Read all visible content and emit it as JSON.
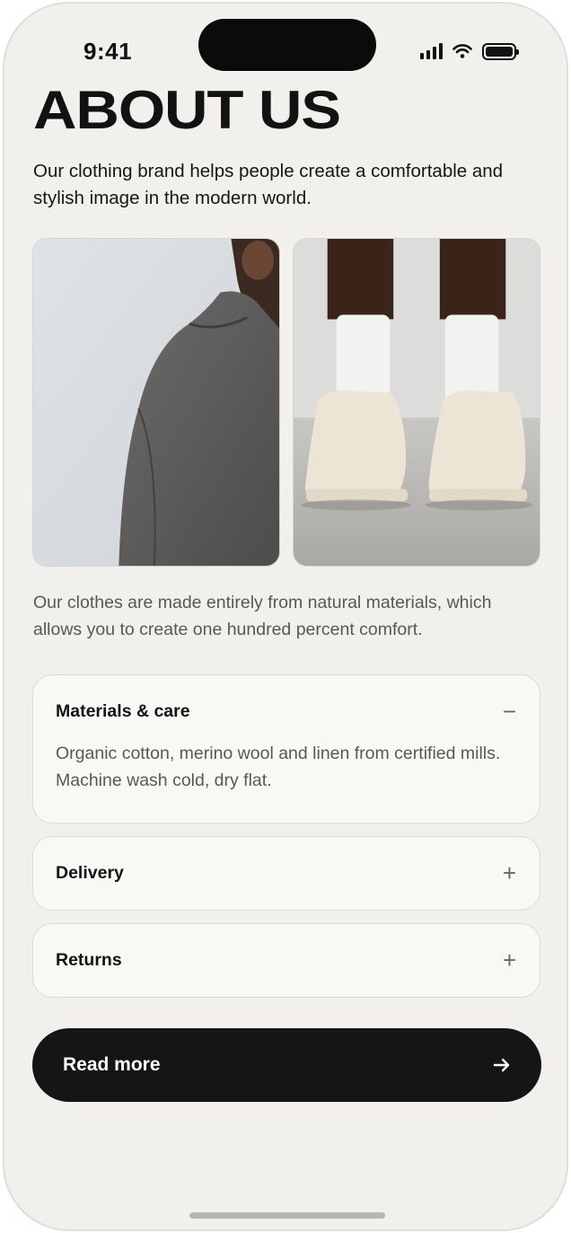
{
  "status_bar": {
    "time": "9:41"
  },
  "page": {
    "title": "ABOUT US",
    "intro": "Our clothing brand helps people create a comfortable and stylish image in the modern world.",
    "body": "Our clothes are made entirely from natural materials, which allows you to create one hundred percent comfort."
  },
  "accordion": [
    {
      "label": "Materials & care",
      "toggle": "−",
      "expanded": true,
      "content": "Organic cotton, merino wool and linen from certified mills. Machine wash cold, dry flat."
    },
    {
      "label": "Delivery",
      "toggle": "+",
      "expanded": false
    },
    {
      "label": "Returns",
      "toggle": "+",
      "expanded": false
    }
  ],
  "cta": {
    "label": "Read more"
  },
  "colors": {
    "background": "#f1f0ec",
    "card": "#f9f8f5",
    "button": "#151515",
    "text": "#121212",
    "muted": "#595855"
  },
  "icons": {
    "cellular": "signal-icon",
    "wifi": "wifi-icon",
    "battery": "battery-icon",
    "arrow": "arrow-right-icon"
  }
}
